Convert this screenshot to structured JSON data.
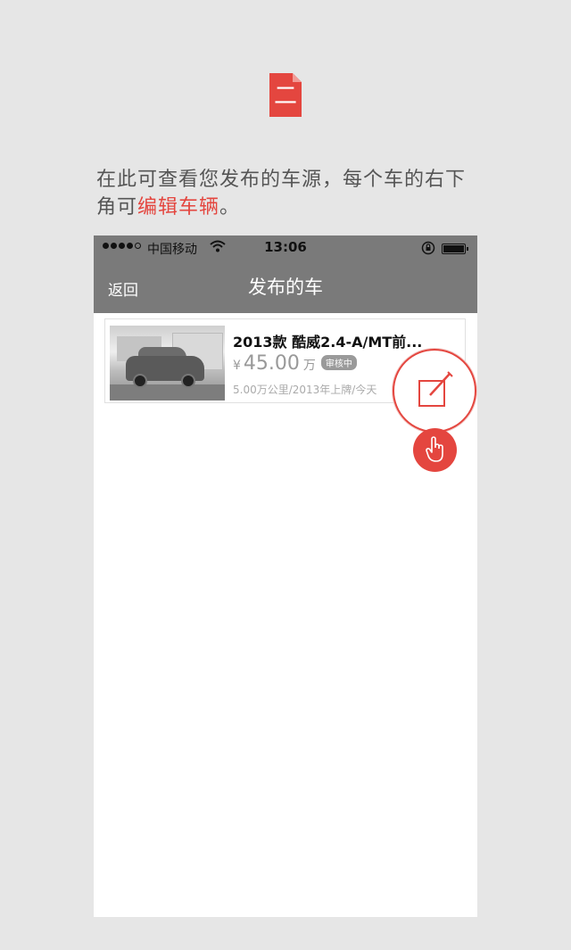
{
  "step": {
    "label": "二",
    "color": "#e4463f"
  },
  "instruction": {
    "text_before": "在此可查看您发布的车源，每个车的右下角可",
    "highlight": "编辑车辆",
    "text_after": "。"
  },
  "statusbar": {
    "carrier": "中国移动",
    "time": "13:06",
    "icons": [
      "signal-dots",
      "wifi-icon",
      "rotation-lock-icon",
      "battery-icon"
    ]
  },
  "navbar": {
    "back_label": "返回",
    "title": "发布的车"
  },
  "listing": {
    "title": "2013款  酷威2.4-A/MT前...",
    "currency": "¥",
    "price": "45.00",
    "unit": "万",
    "status": "审核中",
    "meta": "5.00万公里/2013年上牌/今天"
  },
  "overlay": {
    "edit_icon": "edit-icon",
    "tap_icon": "hand-pointer-icon"
  }
}
